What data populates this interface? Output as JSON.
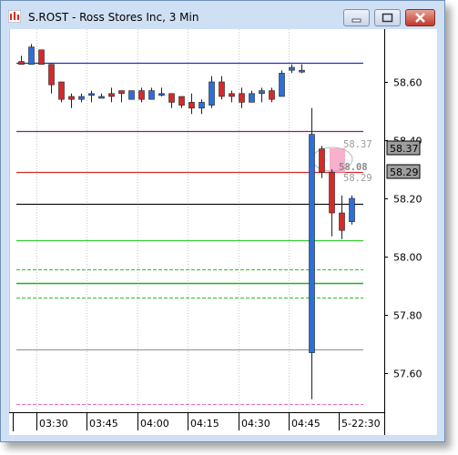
{
  "window": {
    "title": "S.ROST - Ross Stores Inc, 3 Min"
  },
  "chart_data": {
    "type": "candlestick",
    "symbol": "S.ROST",
    "interval": "3 Min",
    "y_ticks": [
      "58.60",
      "58.40",
      "58.20",
      "58.00",
      "57.80",
      "57.60"
    ],
    "y_range": [
      57.49,
      58.76
    ],
    "x_ticks": [
      "03:30",
      "03:45",
      "04:00",
      "04:15",
      "04:30",
      "04:45",
      "5-22:30"
    ],
    "candles": [
      {
        "o": 58.67,
        "h": 58.69,
        "l": 58.66,
        "c": 58.66
      },
      {
        "o": 58.66,
        "h": 58.73,
        "l": 58.66,
        "c": 58.72
      },
      {
        "o": 58.71,
        "h": 58.71,
        "l": 58.66,
        "c": 58.66
      },
      {
        "o": 58.66,
        "h": 58.66,
        "l": 58.56,
        "c": 58.59
      },
      {
        "o": 58.6,
        "h": 58.6,
        "l": 58.53,
        "c": 58.54
      },
      {
        "o": 58.55,
        "h": 58.56,
        "l": 58.51,
        "c": 58.54
      },
      {
        "o": 58.54,
        "h": 58.56,
        "l": 58.53,
        "c": 58.55
      },
      {
        "o": 58.56,
        "h": 58.57,
        "l": 58.53,
        "c": 58.56
      },
      {
        "o": 58.55,
        "h": 58.56,
        "l": 58.55,
        "c": 58.55
      },
      {
        "o": 58.56,
        "h": 58.58,
        "l": 58.53,
        "c": 58.55
      },
      {
        "o": 58.57,
        "h": 58.57,
        "l": 58.53,
        "c": 58.56
      },
      {
        "o": 58.54,
        "h": 58.57,
        "l": 58.54,
        "c": 58.57
      },
      {
        "o": 58.57,
        "h": 58.58,
        "l": 58.53,
        "c": 58.54
      },
      {
        "o": 58.54,
        "h": 58.58,
        "l": 58.54,
        "c": 58.57
      },
      {
        "o": 58.56,
        "h": 58.58,
        "l": 58.55,
        "c": 58.56
      },
      {
        "o": 58.56,
        "h": 58.56,
        "l": 58.51,
        "c": 58.53
      },
      {
        "o": 58.55,
        "h": 58.55,
        "l": 58.51,
        "c": 58.52
      },
      {
        "o": 58.53,
        "h": 58.56,
        "l": 58.49,
        "c": 58.51
      },
      {
        "o": 58.51,
        "h": 58.54,
        "l": 58.49,
        "c": 58.53
      },
      {
        "o": 58.52,
        "h": 58.62,
        "l": 58.51,
        "c": 58.6
      },
      {
        "o": 58.6,
        "h": 58.62,
        "l": 58.54,
        "c": 58.55
      },
      {
        "o": 58.56,
        "h": 58.57,
        "l": 58.53,
        "c": 58.55
      },
      {
        "o": 58.56,
        "h": 58.58,
        "l": 58.51,
        "c": 58.53
      },
      {
        "o": 58.53,
        "h": 58.57,
        "l": 58.53,
        "c": 58.56
      },
      {
        "o": 58.56,
        "h": 58.58,
        "l": 58.53,
        "c": 58.57
      },
      {
        "o": 58.57,
        "h": 58.58,
        "l": 58.53,
        "c": 58.54
      },
      {
        "o": 58.55,
        "h": 58.64,
        "l": 58.55,
        "c": 58.63
      },
      {
        "o": 58.64,
        "h": 58.66,
        "l": 58.63,
        "c": 58.65
      },
      {
        "o": 58.64,
        "h": 58.66,
        "l": 58.63,
        "c": 58.64
      },
      {
        "o": 57.67,
        "h": 58.51,
        "l": 57.51,
        "c": 58.42
      },
      {
        "o": 58.37,
        "h": 58.38,
        "l": 58.27,
        "c": 58.29
      },
      {
        "o": 58.29,
        "h": 58.3,
        "l": 58.07,
        "c": 58.15
      },
      {
        "o": 58.15,
        "h": 58.21,
        "l": 58.06,
        "c": 58.09
      },
      {
        "o": 58.12,
        "h": 58.21,
        "l": 58.11,
        "c": 58.2
      }
    ],
    "bull_color": "#2e6fd6",
    "bear_color": "#d42a2a",
    "horizontal_lines": [
      {
        "y": 58.665,
        "color": "#1c2fd0",
        "dash": false,
        "width": 1.3
      },
      {
        "y": 58.43,
        "color": "#8a1c8a",
        "dash": false,
        "width": 1.2
      },
      {
        "y": 58.29,
        "color": "#d42a2a",
        "dash": false,
        "width": 1.2
      },
      {
        "y": 58.18,
        "color": "#111111",
        "dash": false,
        "width": 1.2
      },
      {
        "y": 58.055,
        "color": "#32c832",
        "dash": false,
        "width": 1.2
      },
      {
        "y": 57.955,
        "color": "#2fbf2f",
        "dash": true,
        "width": 1
      },
      {
        "y": 57.91,
        "color": "#22b022",
        "dash": false,
        "width": 1.6
      },
      {
        "y": 57.86,
        "color": "#2fbf2f",
        "dash": true,
        "width": 1
      },
      {
        "y": 57.68,
        "color": "#909090",
        "dash": false,
        "width": 1
      },
      {
        "y": 57.495,
        "color": "#e070c0",
        "dash": true,
        "width": 1
      }
    ],
    "price_boxes": [
      "58.37",
      "58.29"
    ],
    "price_labels": [
      "58.37",
      "58.08",
      "58.29"
    ]
  }
}
